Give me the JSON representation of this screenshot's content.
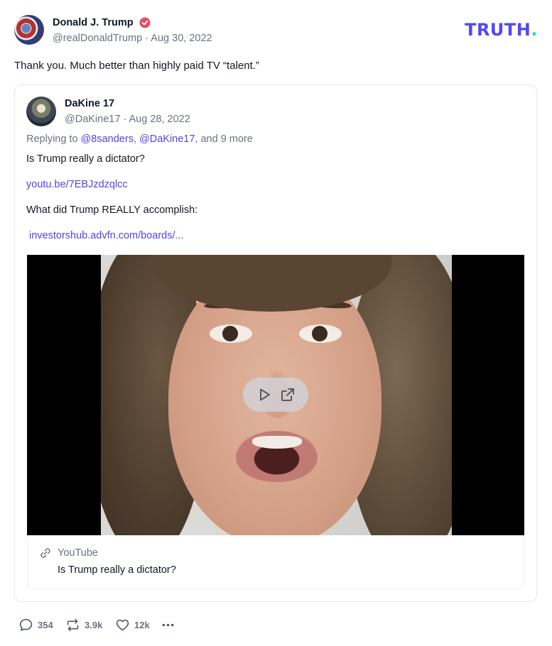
{
  "post": {
    "author_name": "Donald J. Trump",
    "handle": "@realDonaldTrump",
    "date": "Aug 30, 2022",
    "text": "Thank you. Much better than highly paid TV “talent.”"
  },
  "logo": {
    "text": "TRUTH",
    "dot": "."
  },
  "quoted": {
    "author_name": "DaKine 17",
    "handle": "@DaKine17",
    "date": "Aug 28, 2022",
    "replying_prefix": "Replying to ",
    "mention1": "@8sanders",
    "separator": ", ",
    "mention2": "@DaKine17",
    "replying_suffix": ", and 9 more",
    "line1": "Is Trump really a dictator?",
    "link1": "youtu.be/7EBJzdzqlcc",
    "line2": "What did Trump REALLY accomplish:",
    "link2": "investorshub.advfn.com/boards/...",
    "card": {
      "source": "YouTube",
      "title": "Is Trump really a dictator?"
    }
  },
  "actions": {
    "replies": "354",
    "retruths": "3.9k",
    "likes": "12k"
  },
  "colors": {
    "accent": "#4f46e5",
    "logo": "#5448ee",
    "logo_dot": "#17e2c7",
    "verified": "#e0525f"
  },
  "icons": [
    "verified-badge-icon",
    "play-icon",
    "open-external-icon",
    "link-icon",
    "comment-icon",
    "retruth-icon",
    "heart-icon",
    "more-icon"
  ]
}
